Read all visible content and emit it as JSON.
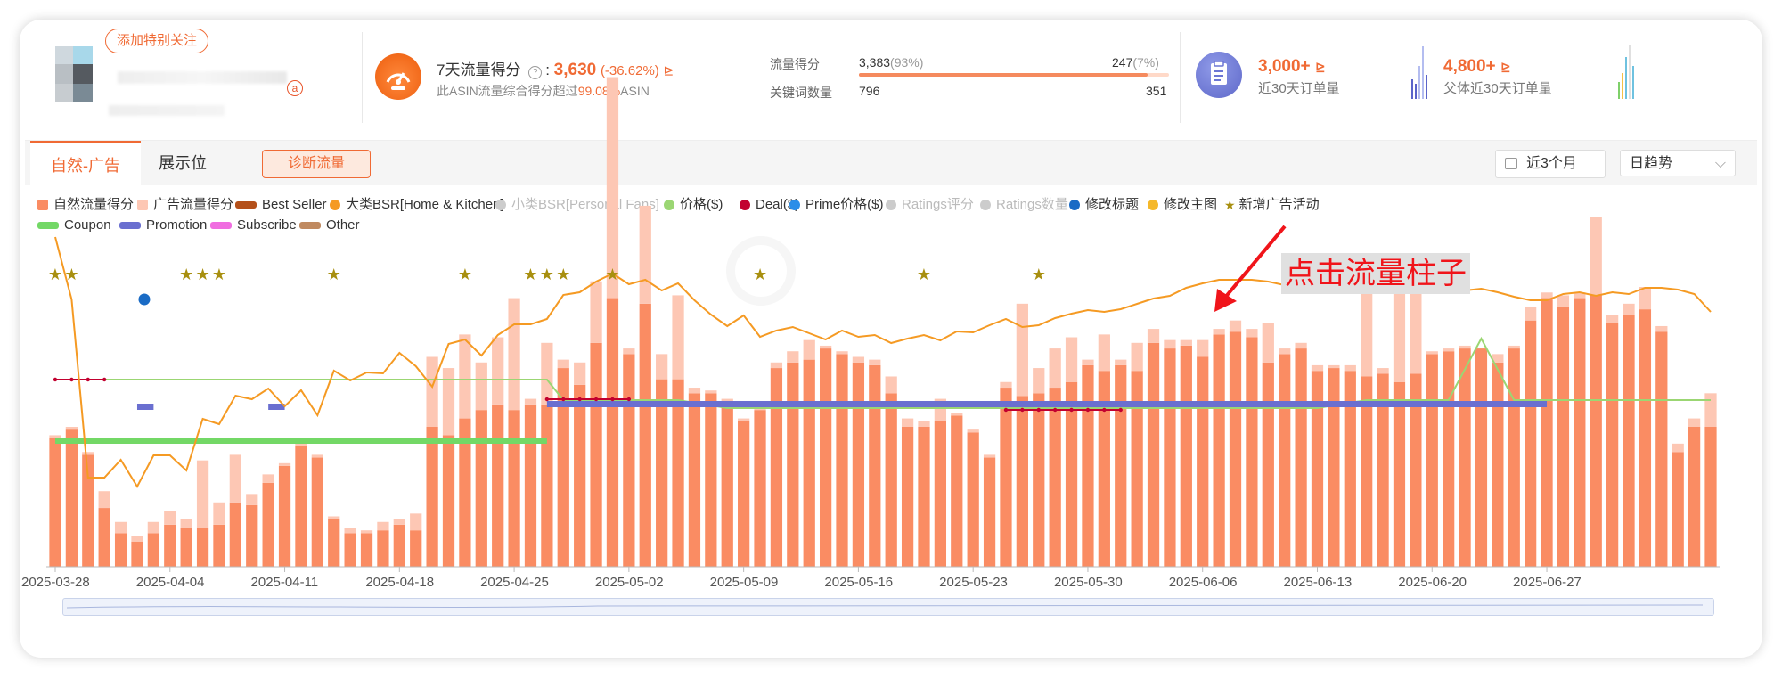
{
  "header": {
    "follow_button": "添加特别关注",
    "amazon_badge": "a",
    "score": {
      "title": "7天流量得分",
      "help_icon": "question-circle-icon",
      "value": "3,630",
      "change": "(-36.62%)",
      "trend_icon": "trend-chart-icon",
      "sub_prefix": "此ASIN流量综合得分超过",
      "sub_pct": "99.08%",
      "sub_suffix": "ASIN"
    },
    "breakdown": {
      "score_label": "流量得分",
      "score_left": "3,383",
      "score_left_pct": "(93%)",
      "score_right": "247",
      "score_right_pct": "(7%)",
      "score_ratio": 0.93,
      "kw_label": "关键词数量",
      "kw_left": "796",
      "kw_right": "351"
    },
    "orders": {
      "value": "3,000+",
      "label": "近30天订单量",
      "parent_value": "4,800+",
      "parent_label": "父体近30天订单量"
    }
  },
  "tabs": {
    "natural_ad": "自然-广告",
    "display": "展示位",
    "diagnose": "诊断流量",
    "range": "近3个月",
    "mode": "日趋势"
  },
  "annotation": "点击流量柱子",
  "colors": {
    "natural": "#fa8c63",
    "ad": "#fdc7b4",
    "bsr": "#f59a23",
    "price": "#9bd673",
    "deal": "#c2002f",
    "promotion": "#6a6fd0",
    "coupon": "#73d866",
    "star": "#a88f0f",
    "title_change": "#1a6bc5"
  },
  "chart_data": {
    "type": "bar",
    "legend": [
      {
        "label": "自然流量得分",
        "color": "#fa8c63",
        "shape": "square",
        "active": true
      },
      {
        "label": "广告流量得分",
        "color": "#fdc7b4",
        "shape": "square",
        "active": true
      },
      {
        "label": "Best Seller",
        "color": "#b4501a",
        "shape": "bar",
        "active": true
      },
      {
        "label": "大类BSR[Home & Kitchen]",
        "color": "#f59a23",
        "shape": "circle",
        "active": true
      },
      {
        "label": "小类BSR[Personal Fans]",
        "color": "#cccccc",
        "shape": "circle",
        "active": false
      },
      {
        "label": "价格($)",
        "color": "#9bd673",
        "shape": "circle",
        "active": true
      },
      {
        "label": "Deal($)",
        "color": "#c2002f",
        "shape": "circle",
        "active": true
      },
      {
        "label": "Prime价格($)",
        "color": "#2b8ee8",
        "shape": "circle",
        "active": true
      },
      {
        "label": "Ratings评分",
        "color": "#cccccc",
        "shape": "circle",
        "active": false
      },
      {
        "label": "Ratings数量",
        "color": "#cccccc",
        "shape": "circle",
        "active": false
      },
      {
        "label": "修改标题",
        "color": "#1a6bc5",
        "shape": "circle",
        "active": true
      },
      {
        "label": "修改主图",
        "color": "#f5b82a",
        "shape": "circle",
        "active": true
      },
      {
        "label": "新增广告活动",
        "color": "#a88f0f",
        "shape": "star",
        "active": true
      },
      {
        "label": "Coupon",
        "color": "#73d866",
        "shape": "bar",
        "active": true
      },
      {
        "label": "Promotion",
        "color": "#6a6fd0",
        "shape": "bar",
        "active": true
      },
      {
        "label": "Subscribe",
        "color": "#f06de0",
        "shape": "bar",
        "active": true
      },
      {
        "label": "Other",
        "color": "#c08a60",
        "shape": "bar",
        "active": true
      }
    ],
    "x_ticks": [
      "2025-03-28",
      "2025-04-04",
      "2025-04-11",
      "2025-04-18",
      "2025-04-25",
      "2025-05-02",
      "2025-05-09",
      "2025-05-16",
      "2025-05-23",
      "2025-05-30",
      "2025-06-06",
      "2025-06-13",
      "2025-06-20",
      "2025-06-27"
    ],
    "natural": [
      46,
      49,
      40,
      21,
      12,
      9,
      12,
      15,
      14,
      14,
      15,
      23,
      22,
      30,
      36,
      43,
      39,
      17,
      12,
      12,
      13,
      15,
      13,
      50,
      47,
      53,
      56,
      58,
      56,
      58,
      58,
      71,
      65,
      80,
      96,
      76,
      94,
      67,
      67,
      62,
      62,
      58,
      52,
      56,
      71,
      73,
      74,
      78,
      76,
      73,
      72,
      62,
      50,
      50,
      52,
      54,
      48,
      39,
      64,
      61,
      62,
      64,
      66,
      72,
      70,
      72,
      70,
      80,
      78,
      79,
      75,
      83,
      84,
      82,
      73,
      76,
      78,
      70,
      71,
      70,
      68,
      69,
      66,
      69,
      76,
      77,
      78,
      78,
      73,
      78,
      88,
      96,
      93,
      96,
      97,
      87,
      90,
      92,
      84,
      41,
      50,
      50
    ],
    "ad": [
      1,
      1,
      1,
      6,
      4,
      2,
      4,
      5,
      3,
      24,
      8,
      17,
      4,
      3,
      1,
      1,
      1,
      1,
      2,
      1,
      3,
      2,
      6,
      25,
      24,
      30,
      17,
      24,
      40,
      2,
      22,
      3,
      8,
      22,
      79,
      2,
      35,
      9,
      30,
      2,
      1,
      2,
      1,
      1,
      2,
      4,
      7,
      1,
      1,
      2,
      2,
      6,
      3,
      2,
      8,
      1,
      1,
      1,
      2,
      33,
      9,
      14,
      16,
      2,
      13,
      2,
      10,
      5,
      3,
      2,
      6,
      2,
      4,
      3,
      14,
      2,
      2,
      2,
      1,
      2,
      44,
      2,
      32,
      38,
      1,
      1,
      1,
      0,
      3,
      1,
      5,
      2,
      4,
      2,
      28,
      3,
      4,
      8,
      2,
      3,
      3,
      12
    ],
    "bsr": [
      370,
      300,
      100,
      100,
      120,
      90,
      125,
      125,
      108,
      166,
      160,
      192,
      188,
      200,
      180,
      198,
      170,
      220,
      209,
      218,
      217,
      240,
      225,
      202,
      250,
      255,
      237,
      260,
      272,
      272,
      278,
      305,
      308,
      320,
      329,
      317,
      322,
      310,
      318,
      299,
      283,
      270,
      282,
      258,
      265,
      269,
      262,
      255,
      265,
      258,
      260,
      251,
      256,
      260,
      254,
      264,
      263,
      271,
      278,
      269,
      271,
      279,
      284,
      288,
      286,
      289,
      295,
      301,
      304,
      313,
      318,
      322,
      322,
      322,
      320,
      316,
      318,
      316,
      318,
      315,
      313,
      314,
      318,
      315,
      319,
      314,
      310,
      312,
      308,
      303,
      299,
      299,
      306,
      308,
      304,
      308,
      306,
      313,
      313,
      311,
      306,
      286
    ],
    "bsr_unit_note": "",
    "events": {
      "new_ad_campaign": [
        "2025-03-28",
        "2025-03-29",
        "2025-04-05",
        "2025-04-06",
        "2025-04-07",
        "2025-04-14",
        "2025-04-22",
        "2025-04-26",
        "2025-04-27",
        "2025-04-28",
        "2025-05-01",
        "2025-05-10",
        "2025-05-20",
        "2025-05-27"
      ],
      "title_change": [
        "2025-04-02"
      ]
    },
    "promotions": {
      "coupon": [
        [
          "2025-03-28",
          "2025-04-27"
        ],
        [
          "2025-06-20",
          "2025-06-27"
        ]
      ],
      "promotion": [
        [
          "2025-04-02",
          "2025-04-03"
        ],
        [
          "2025-04-10",
          "2025-04-11"
        ],
        [
          "2025-04-27",
          "2025-06-27"
        ]
      ],
      "deal": [
        [
          "2025-03-28",
          "2025-03-31"
        ],
        [
          "2025-04-27",
          "2025-05-02"
        ],
        [
          "2025-05-25",
          "2025-06-01"
        ]
      ]
    },
    "ylim": [
      0,
      100
    ]
  }
}
